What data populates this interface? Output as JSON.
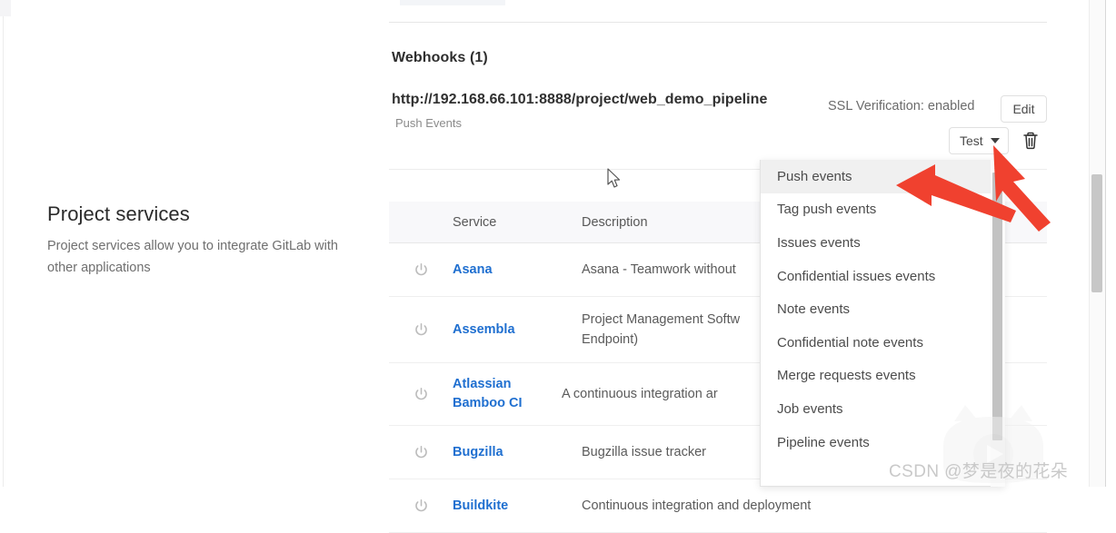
{
  "webhooks": {
    "section_title": "Webhooks (1)",
    "url": "http://192.168.66.101:8888/project/web_demo_pipeline",
    "events_label": "Push Events",
    "ssl_label": "SSL Verification: enabled",
    "edit_label": "Edit",
    "test_label": "Test",
    "delete_icon": "trash-icon",
    "caret_icon": "chevron-down-icon"
  },
  "test_menu": {
    "items": [
      "Push events",
      "Tag push events",
      "Issues events",
      "Confidential issues events",
      "Note events",
      "Confidential note events",
      "Merge requests events",
      "Job events",
      "Pipeline events"
    ],
    "active_index": 0
  },
  "services_intro": {
    "heading": "Project services",
    "description": "Project services allow you to integrate GitLab with other applications"
  },
  "services_table": {
    "columns": [
      "Service",
      "Description"
    ],
    "rows": [
      {
        "icon": "power-icon",
        "name": "Asana",
        "description": "Asana - Teamwork without"
      },
      {
        "icon": "power-icon",
        "name": "Assembla",
        "description": "Project Management Softw\nEndpoint)"
      },
      {
        "icon": "power-icon",
        "name": "Atlassian Bamboo CI",
        "description": "A continuous integration ar"
      },
      {
        "icon": "power-icon",
        "name": "Bugzilla",
        "description": "Bugzilla issue tracker"
      },
      {
        "icon": "power-icon",
        "name": "Buildkite",
        "description": "Continuous integration and deployment"
      }
    ]
  },
  "watermark": {
    "text": "CSDN @梦是夜的花朵"
  },
  "colors": {
    "link": "#1f6fd0",
    "annotation": "#f0412f",
    "header_bg": "#f8f8fa",
    "menu_active": "#f0f0f0"
  }
}
